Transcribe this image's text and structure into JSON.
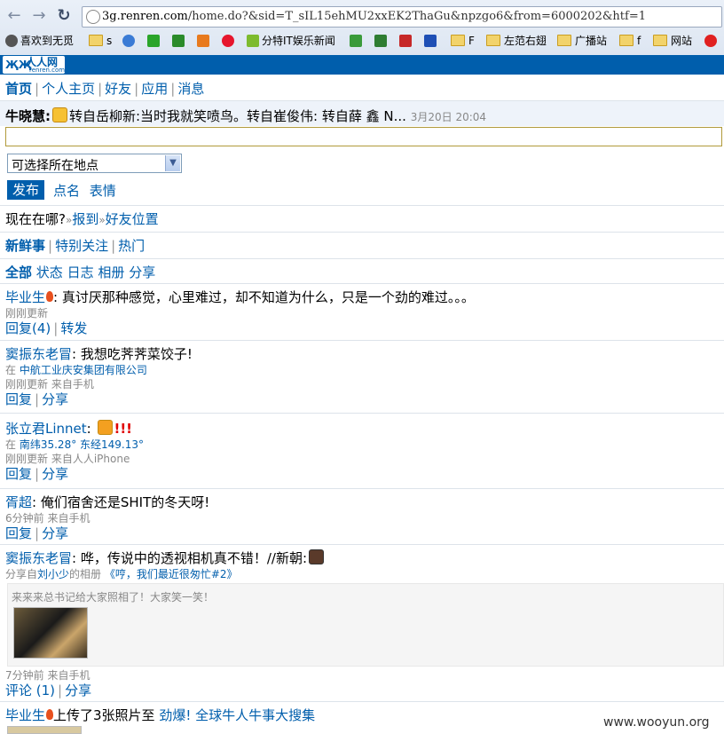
{
  "browser": {
    "url_host": "3g.renren.com",
    "url_rest": "/home.do?&sid=T_sIL15ehMU2xxEK2ThaGu&npzgo6&from=6000202&htf=1",
    "bookmarks": [
      {
        "label": "喜欢到无觅",
        "icon": "gear-icon"
      },
      {
        "label": "s",
        "icon": "folder-icon"
      },
      {
        "label": "",
        "icon": "bluebird-icon"
      },
      {
        "label": "",
        "icon": "play-icon"
      },
      {
        "label": "",
        "icon": "t-icon"
      },
      {
        "label": "",
        "icon": "zhi-icon"
      },
      {
        "label": "",
        "icon": "weibo-icon"
      },
      {
        "label": "分特IT娱乐新闻",
        "icon": "leaf-icon"
      },
      {
        "label": "",
        "icon": "pai-icon"
      },
      {
        "label": "",
        "icon": "shi-icon"
      },
      {
        "label": "",
        "icon": "box-icon"
      },
      {
        "label": "",
        "icon": "paw-icon"
      },
      {
        "label": "F",
        "icon": "folder-icon"
      },
      {
        "label": "左范右翅",
        "icon": "folder-icon"
      },
      {
        "label": "广播站",
        "icon": "folder-icon"
      },
      {
        "label": "f",
        "icon": "folder-icon"
      },
      {
        "label": "网站",
        "icon": "folder-icon"
      },
      {
        "label": "",
        "icon": "sohu-icon"
      }
    ],
    "colors": {
      "accent": "#005eac"
    }
  },
  "site": {
    "logo_text": "人人网",
    "logo_sub": "renren.com"
  },
  "nav": {
    "items": [
      "首页",
      "个人主页",
      "好友",
      "应用",
      "消息"
    ]
  },
  "status": {
    "name": "牛晓慧:",
    "text": "转自岳柳新:当时我就笑喷鸟。转自崔俊伟: 转自薛 鑫 N...",
    "time": "3月20日 20:04",
    "location_select": "可选择所在地点",
    "publish_label": "发布",
    "extra": [
      "点名",
      "表情"
    ]
  },
  "where": {
    "question": "现在在哪?",
    "checkin": "报到",
    "friends": "好友位置",
    "chev": "»"
  },
  "feedtabs": {
    "items": [
      "新鲜事",
      "特别关注",
      "热门"
    ]
  },
  "filters": {
    "items": [
      "全部",
      "状态",
      "日志",
      "相册",
      "分享"
    ]
  },
  "feed": [
    {
      "name": "毕业生",
      "text": ": 真讨厌那种感觉，心里难过，却不知道为什么，只是一个劲的难过。。。",
      "time": "刚刚更新",
      "actions": [
        "回复(4)",
        "转发"
      ]
    },
    {
      "name": "窦振东老冒",
      "text": ": 我想吃荠荠菜饺子!",
      "loc_pre": "在",
      "loc": "中航工业庆安集团有限公司",
      "time": "刚刚更新 来自手机",
      "actions": [
        "回复",
        "分享"
      ]
    },
    {
      "name": "张立君Linnet",
      "text": ":",
      "excl": "!!!",
      "loc_pre": "在",
      "loc": "南纬35.28° 东经149.13°",
      "time": "刚刚更新 来自人人iPhone",
      "actions": [
        "回复",
        "分享"
      ]
    },
    {
      "name": "胥超",
      "text": ": 俺们宿舍还是SHIT的冬天呀!",
      "time": "6分钟前 来自手机",
      "actions": [
        "回复",
        "分享"
      ]
    },
    {
      "name": "窦振东老冒",
      "text": ": 哗，传说中的透视相机真不错！//新朝:",
      "share_pre": "分享自",
      "share_from": "刘小少",
      "share_mid": "的相册",
      "share_title": "《哼，我们最近很匆忙#2》",
      "quote": "来来来总书记给大家照相了！大家笑一笑！",
      "time": "7分钟前 来自手机",
      "actions": [
        "评论 (1)",
        "分享"
      ]
    },
    {
      "name": "毕业生",
      "text": "上传了3张照片至",
      "album1": "劲爆!",
      "album2": "全球牛人牛事大搜集"
    }
  ],
  "watermark": "www.wooyun.org"
}
